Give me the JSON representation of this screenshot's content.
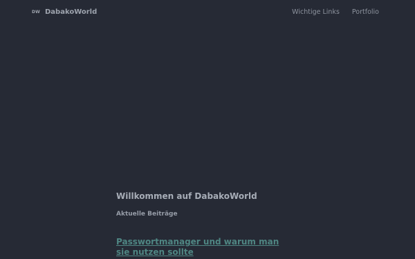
{
  "header": {
    "logo_mark": "DW",
    "site_name": "DabakoWorld",
    "nav": [
      {
        "label": "Wichtige Links"
      },
      {
        "label": "Portfolio"
      }
    ]
  },
  "main": {
    "title": "Willkommen auf DabakoWorld",
    "section_heading": "Aktuelle Beiträge",
    "posts": [
      {
        "title": "Passwortmanager und warum man sie nutzen sollte"
      }
    ]
  }
}
